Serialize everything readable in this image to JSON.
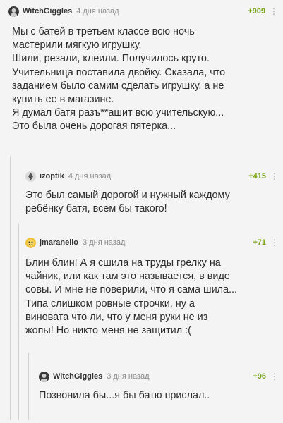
{
  "comments": [
    {
      "user": "WitchGiggles",
      "time": "4 дня назад",
      "rating": "+909",
      "more": "⋮",
      "text": "Мы с батей в третьем классе всю ночь\nмастерили мягкую игрушку.\nШили, резали, клеили. Получилось круто.\nУчительница поставила двойку. Сказала, что\nзаданием было самим сделать игрушку, а не\nкупить ее в магазине.\nЯ думал батя разъ**ашит всю учительскую...\nЭто была очень дорогая пятерка..."
    },
    {
      "user": "izoptik",
      "time": "4 дня назад",
      "rating": "+415",
      "more": "⋮",
      "text": "Это был самый дорогой и нужный каждому\nребёнку батя, всем бы такого!"
    },
    {
      "user": "jmaranello",
      "time": "3 дня назад",
      "rating": "+71",
      "more": "⋮",
      "text": "Блин блин! А я сшила на труды грелку на\nчайник, или как там это называется, в виде\nсовы. И мне не поверили, что я сама шила...\nТипа слишком ровные строчки, ну а\nвиновата что ли, что у меня руки не из\nжопы! Но никто меня не защитил :("
    },
    {
      "user": "WitchGiggles",
      "time": "3 дня назад",
      "rating": "+96",
      "more": "⋮",
      "text": "Позвонила бы...я бы батю прислал.."
    }
  ]
}
